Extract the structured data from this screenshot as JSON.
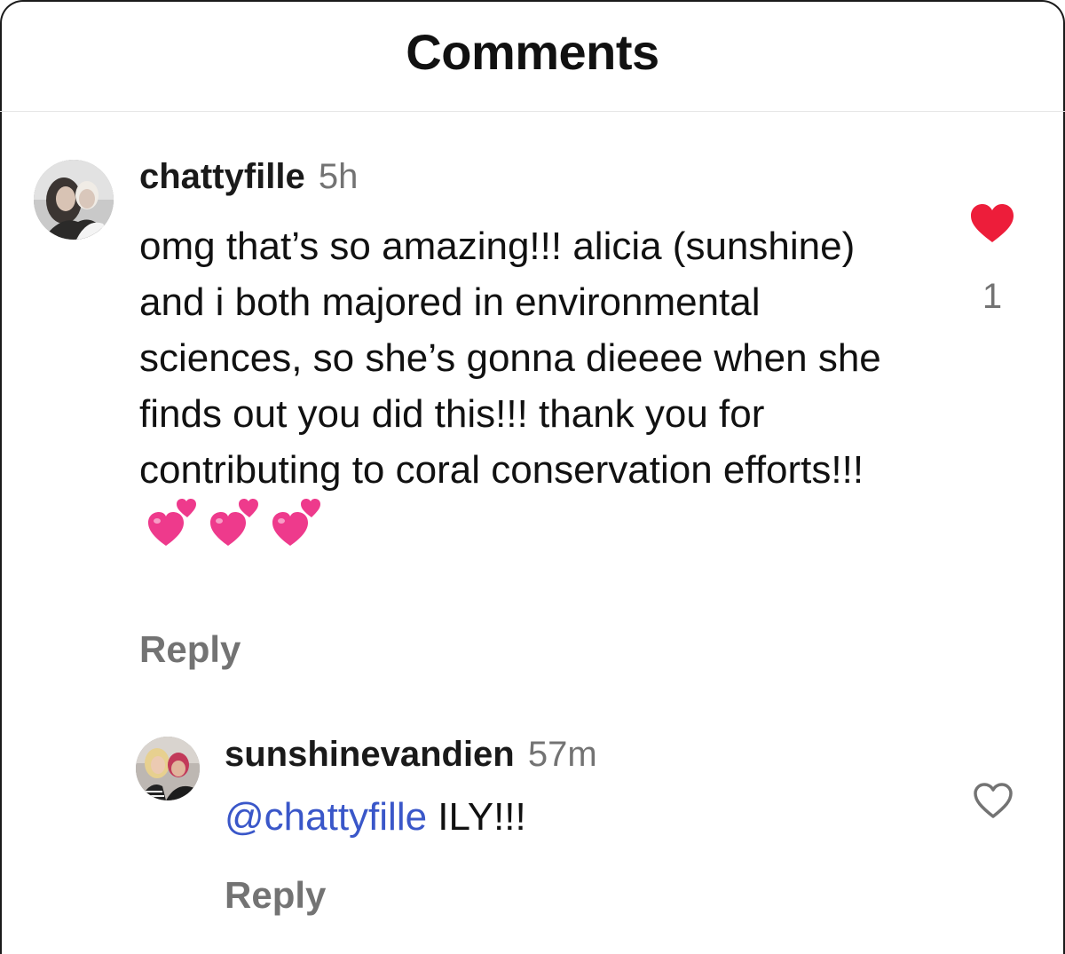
{
  "header": {
    "title": "Comments"
  },
  "comments": [
    {
      "avatar_icon": "user-avatar-photo",
      "username": "chattyfille",
      "time": "5h",
      "text": "omg that’s so amazing!!! alicia (sunshine) and i both majored in environmental sciences, so she’s gonna dieeee when she finds out you did this!!! thank you for contributing to coral conservation efforts!!!",
      "emoji": "💞💞💞",
      "reply_label": "Reply",
      "liked": true,
      "like_icon": "heart-filled-icon",
      "like_color": "#ed1d3a",
      "like_count": "1"
    },
    {
      "avatar_icon": "user-avatar-photo",
      "username": "sunshinevandien",
      "time": "57m",
      "mention": "@chattyfille",
      "text": " ILY!!!",
      "reply_label": "Reply",
      "liked": false,
      "like_icon": "heart-outline-icon"
    }
  ],
  "colors": {
    "text": "#111111",
    "muted": "#737373",
    "mention": "#3a57c9",
    "like": "#ed1d3a"
  }
}
